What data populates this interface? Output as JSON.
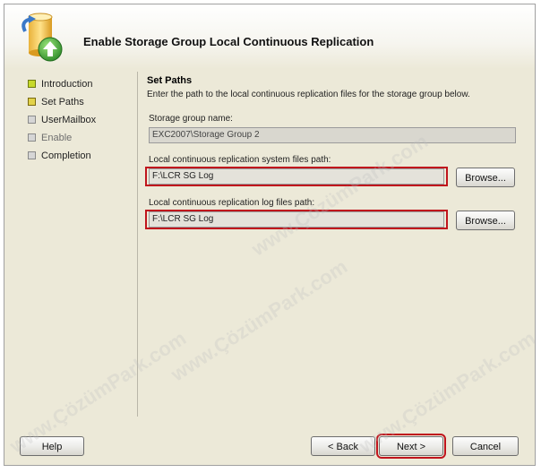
{
  "header": {
    "title": "Enable Storage Group Local Continuous Replication"
  },
  "nav": {
    "items": [
      {
        "label": "Introduction",
        "state": "done"
      },
      {
        "label": "Set Paths",
        "state": "current"
      },
      {
        "label": "UserMailbox",
        "state": "pending"
      },
      {
        "label": "Enable",
        "state": "pending"
      },
      {
        "label": "Completion",
        "state": "pending"
      }
    ]
  },
  "content": {
    "section_title": "Set Paths",
    "description": "Enter the path to the local continuous replication files for the storage group below.",
    "storage_group": {
      "label": "Storage group name:",
      "value": "EXC2007\\Storage Group 2"
    },
    "system_files": {
      "label": "Local continuous replication system files path:",
      "value": "F:\\LCR SG Log",
      "browse_label": "Browse..."
    },
    "log_files": {
      "label": "Local continuous replication log files path:",
      "value": "F:\\LCR SG Log",
      "browse_label": "Browse..."
    }
  },
  "footer": {
    "help_label": "Help",
    "back_label": "< Back",
    "next_label": "Next >",
    "cancel_label": "Cancel"
  },
  "watermark": {
    "text": "www.ÇözümPark.com"
  },
  "colors": {
    "highlight": "#c0141c",
    "dialog_bg": "#ece9d8"
  }
}
